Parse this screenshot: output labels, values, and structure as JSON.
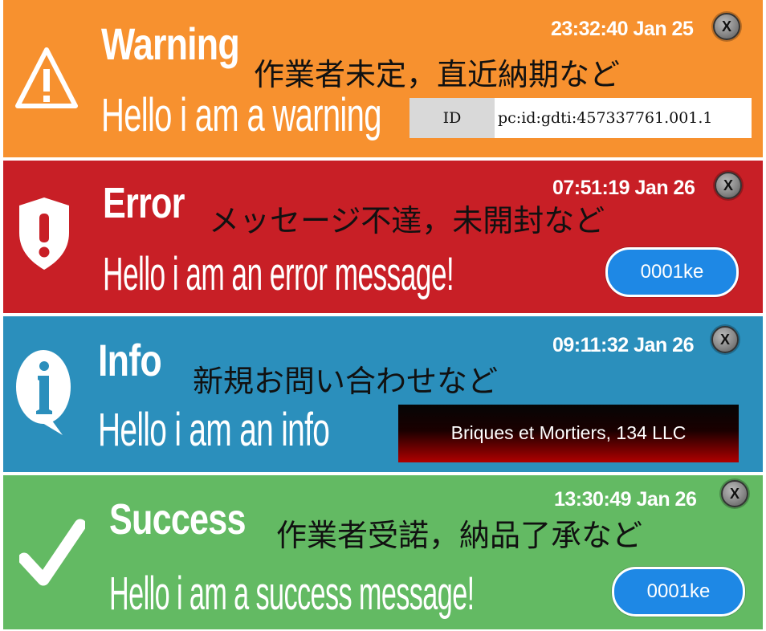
{
  "notifications": [
    {
      "type": "warning",
      "title": "Warning",
      "message": "Hello i am a warning",
      "subtitle_jp": "作業者未定，直近納期など",
      "timestamp": "23:32:40 Jan 25",
      "close_label": "X",
      "id_label": "ID",
      "id_value": "pc:id:gdti:457337761.001.1",
      "icon": "warning-triangle-icon",
      "color": "#f7912f"
    },
    {
      "type": "error",
      "title": "Error",
      "message": "Hello i am an error message!",
      "subtitle_jp": "メッセージ不達，未開封など",
      "timestamp": "07:51:19 Jan 26",
      "close_label": "X",
      "badge": "0001ke",
      "icon": "shield-alert-icon",
      "color": "#c81f26"
    },
    {
      "type": "info",
      "title": "Info",
      "message": "Hello i am an info",
      "subtitle_jp": "新規お問い合わせなど",
      "timestamp": "09:11:32 Jan 26",
      "close_label": "X",
      "company": "Briques et Mortiers, 134 LLC",
      "icon": "info-speech-bubble-icon",
      "color": "#2b8fbc"
    },
    {
      "type": "success",
      "title": "Success",
      "message": "Hello i am a success message!",
      "subtitle_jp": "作業者受諾，納品了承など",
      "timestamp": "13:30:49 Jan 26",
      "close_label": "X",
      "badge": "0001ke",
      "icon": "checkmark-icon",
      "color": "#63ba63"
    }
  ]
}
